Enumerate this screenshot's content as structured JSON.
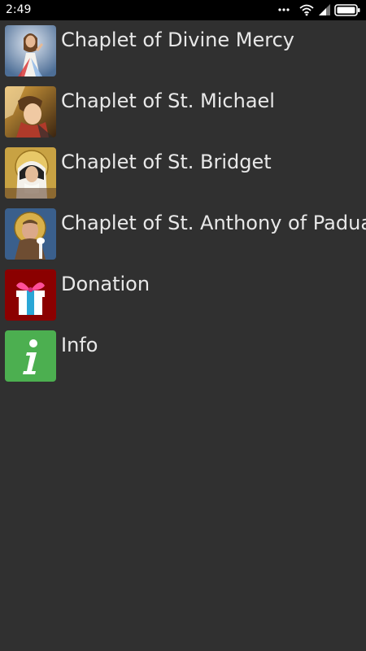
{
  "status_bar": {
    "time": "2:49",
    "icons": [
      "more-dots-icon",
      "wifi-icon",
      "signal-icon",
      "battery-icon"
    ]
  },
  "menu": {
    "items": [
      {
        "label": "Chaplet of Divine Mercy",
        "icon": "divine-mercy-image"
      },
      {
        "label": "Chaplet of St. Michael",
        "icon": "st-michael-image"
      },
      {
        "label": "Chaplet of St. Bridget",
        "icon": "st-bridget-image"
      },
      {
        "label": "Chaplet of St. Anthony of Padua",
        "icon": "st-anthony-image"
      },
      {
        "label": "Donation",
        "icon": "gift-icon"
      },
      {
        "label": "Info",
        "icon": "info-icon"
      }
    ]
  },
  "colors": {
    "background": "#303030",
    "status_bar": "#000000",
    "text": "#e8e8e8",
    "donation_icon_bg": "#8b0000",
    "info_icon_bg": "#4caf50"
  }
}
